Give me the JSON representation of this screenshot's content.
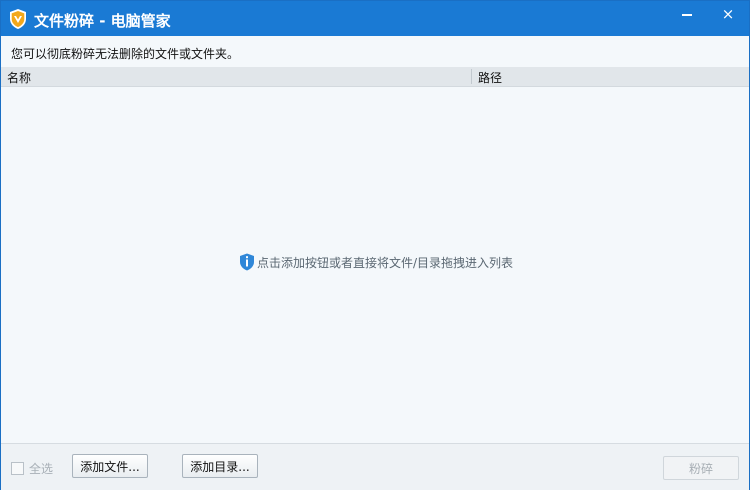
{
  "window": {
    "title": "文件粉碎 - 电脑管家",
    "minimize_label": "",
    "close_label": "×"
  },
  "description": "您可以彻底粉碎无法删除的文件或文件夹。",
  "list": {
    "columns": [
      "名称",
      "路径"
    ],
    "rows": [],
    "empty_hint": "点击添加按钮或者直接将文件/目录拖拽进入列表"
  },
  "footer": {
    "select_all_label": "全选",
    "select_all_checked": false,
    "add_file_label": "添加文件...",
    "add_dir_label": "添加目录...",
    "shred_label": "粉碎",
    "shred_enabled": false
  },
  "colors": {
    "titlebar": "#1a7ad4",
    "background": "#f4f8fb",
    "hint_icon": "#2f87d8"
  },
  "icons": {
    "app": "shield-logo-icon",
    "minimize": "minimize-icon",
    "close": "close-icon",
    "hint": "info-icon"
  }
}
